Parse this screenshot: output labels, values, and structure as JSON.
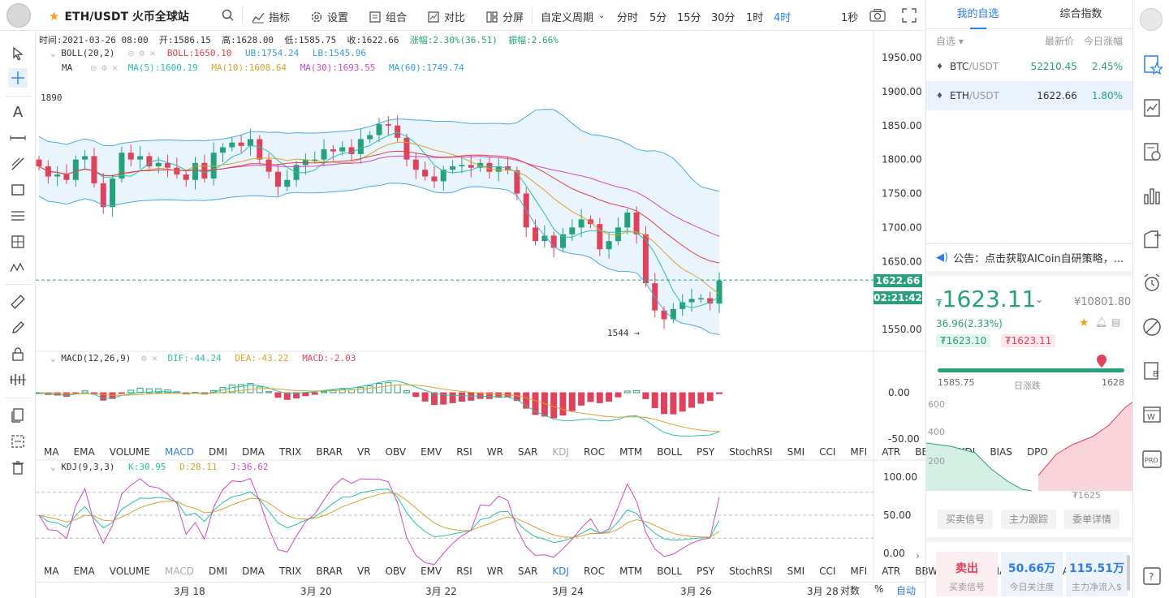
{
  "header": {
    "symbol": "ETH/USDT 火币全球站",
    "toolbar": {
      "indicator": "指标",
      "settings": "设置",
      "combo": "组合",
      "compare": "对比",
      "split": "分屏"
    },
    "periods": [
      "自定义周期",
      "分时",
      "5分",
      "15分",
      "30分",
      "1时",
      "4时"
    ],
    "active_period": "4时",
    "refresh": "1秒"
  },
  "ohlc": {
    "time": "时间:2021-03-26 08:00",
    "open": "开:1586.15",
    "high": "高:1628.00",
    "low": "低:1585.75",
    "close": "收:1622.66",
    "change": "涨幅:2.30%(36.51)",
    "amplitude": "振幅:2.66%"
  },
  "boll": {
    "label": "BOLL(20,2)",
    "mid": "BOLL:1650.10",
    "ub": "UB:1754.24",
    "lb": "LB:1545.96"
  },
  "ma": {
    "label": "MA",
    "ma5": "MA(5):1600.19",
    "ma10": "MA(10):1608.64",
    "ma30": "MA(30):1693.55",
    "ma60": "MA(60):1749.74"
  },
  "macd": {
    "label": "MACD(12,26,9)",
    "dif": "DIF:-44.24",
    "dea": "DEA:-43.22",
    "macd": "MACD:-2.03"
  },
  "kdj": {
    "label": "KDJ(9,3,3)",
    "k": "K:30.95",
    "d": "D:28.11",
    "j": "J:36.62"
  },
  "price_axis": [
    "1950.00",
    "1900.00",
    "1850.00",
    "1800.00",
    "1750.00",
    "1700.00",
    "1650.00",
    "1550.00"
  ],
  "macd_axis": [
    "0.00",
    "-50.00"
  ],
  "kdj_axis": [
    "100.00",
    "50.00",
    "0.00"
  ],
  "annotations": {
    "high": "1890",
    "low": "1544"
  },
  "current_price_tag": "1622.66",
  "countdown_tag": "02:21:42",
  "indicator_tabs": [
    "MA",
    "EMA",
    "VOLUME",
    "MACD",
    "DMI",
    "DMA",
    "TRIX",
    "BRAR",
    "VR",
    "OBV",
    "EMV",
    "RSI",
    "WR",
    "SAR",
    "KDJ",
    "ROC",
    "MTM",
    "BOLL",
    "PSY",
    "StochRSI",
    "SMI",
    "CCI",
    "MFI",
    "ATR",
    "BBW",
    "SKDJ",
    "BIAS",
    "DPO",
    "AO"
  ],
  "x_axis": [
    "3月 18",
    "3月 20",
    "3月 22",
    "3月 24",
    "3月 26",
    "3月 28"
  ],
  "bottom_controls": {
    "log": "对数",
    "pct": "%",
    "auto": "自动"
  },
  "watchlist": {
    "tabs": [
      "我的自选",
      "综合指数"
    ],
    "head": {
      "group": "自选",
      "latest": "最新价",
      "change": "今日涨幅"
    },
    "rows": [
      {
        "name": "BTC",
        "quote": "/USDT",
        "price": "52210.45",
        "change": "2.45%"
      },
      {
        "name": "ETH",
        "quote": "/USDT",
        "price": "1622.66",
        "change": "1.80%"
      }
    ]
  },
  "notice": "公告：点击获取AICoin自研策略，...",
  "detail": {
    "price_prefix": "₮",
    "price": "1623.11",
    "cny": "¥10801.80",
    "change": "36.96(2.33%)",
    "bid": "₮1623.10",
    "ask": "₮1623.11",
    "low": "1585.75",
    "range_label": "日涨跌",
    "high": "1628",
    "depth_axis": [
      "600",
      "400",
      "200"
    ],
    "depth_mid": "₮1625",
    "buttons": [
      "买卖信号",
      "主力跟踪",
      "委单详情"
    ],
    "stats": [
      {
        "value": "卖出",
        "label": "买卖信号"
      },
      {
        "value": "50.66万",
        "label": "今日关注度"
      },
      {
        "value": "115.51万",
        "label": "主力净流入$"
      }
    ]
  },
  "colors": {
    "up": "#26a17b",
    "down": "#e0415b",
    "accent": "#2b7de9",
    "ma5": "#25c3a9",
    "ma10": "#d9a32a",
    "ma30": "#d147c4",
    "ma60": "#32a0d6",
    "boll_mid": "#e04040",
    "boll_band": "#4aa8e8"
  }
}
